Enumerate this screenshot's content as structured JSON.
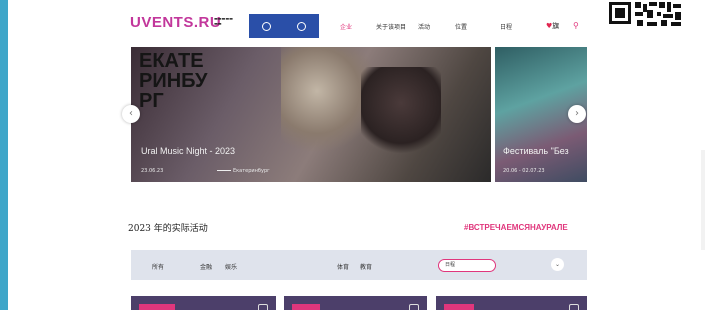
{
  "header": {
    "logo": "UVENTS.RU",
    "logo_tagline": "",
    "nav": [
      "企业",
      "关于该项目",
      "活动",
      "位置",
      "日程"
    ],
    "favorites": "旗",
    "accent_color": "#e0367c"
  },
  "slider": {
    "slides": [
      {
        "title": "Ural Music Night - 2023",
        "date": "23.06.23",
        "place": "Екатеринбург",
        "banner_text": "ЕКАТЕРИНБУРГ"
      },
      {
        "title": "Фестиваль \"Без",
        "date": "20.06 - 02.07.23",
        "place": ""
      }
    ]
  },
  "section": {
    "title": "2023 年的实际活动",
    "hashtag": "#ВСТРЕЧАЕМСЯНАУРАЛЕ"
  },
  "filters": {
    "items": [
      "所有",
      "金融",
      "娱乐",
      "体育",
      "教育"
    ],
    "date_placeholder": "日程"
  }
}
